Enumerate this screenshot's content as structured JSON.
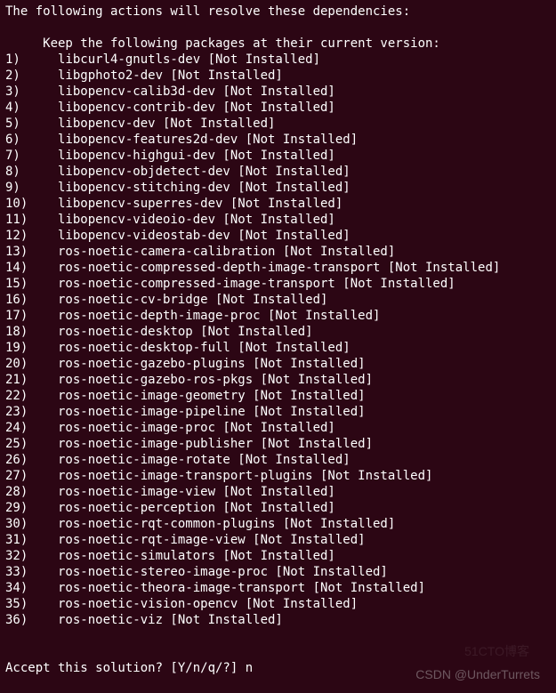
{
  "intro": "The following actions will resolve these dependencies:",
  "keep_header": "     Keep the following packages at their current version:",
  "suffix": "[Not Installed]",
  "packages": [
    "libcurl4-gnutls-dev",
    "libgphoto2-dev",
    "libopencv-calib3d-dev",
    "libopencv-contrib-dev",
    "libopencv-dev",
    "libopencv-features2d-dev",
    "libopencv-highgui-dev",
    "libopencv-objdetect-dev",
    "libopencv-stitching-dev",
    "libopencv-superres-dev",
    "libopencv-videoio-dev",
    "libopencv-videostab-dev",
    "ros-noetic-camera-calibration",
    "ros-noetic-compressed-depth-image-transport",
    "ros-noetic-compressed-image-transport",
    "ros-noetic-cv-bridge",
    "ros-noetic-depth-image-proc",
    "ros-noetic-desktop",
    "ros-noetic-desktop-full",
    "ros-noetic-gazebo-plugins",
    "ros-noetic-gazebo-ros-pkgs",
    "ros-noetic-image-geometry",
    "ros-noetic-image-pipeline",
    "ros-noetic-image-proc",
    "ros-noetic-image-publisher",
    "ros-noetic-image-rotate",
    "ros-noetic-image-transport-plugins",
    "ros-noetic-image-view",
    "ros-noetic-perception",
    "ros-noetic-rqt-common-plugins",
    "ros-noetic-rqt-image-view",
    "ros-noetic-simulators",
    "ros-noetic-stereo-image-proc",
    "ros-noetic-theora-image-transport",
    "ros-noetic-vision-opencv",
    "ros-noetic-viz"
  ],
  "prompt_label": "Accept this solution? [Y/n/q/?] ",
  "prompt_answer": "n",
  "watermarks": {
    "w1": "51CTO博客",
    "w2": "CSDN @UnderTurrets"
  }
}
